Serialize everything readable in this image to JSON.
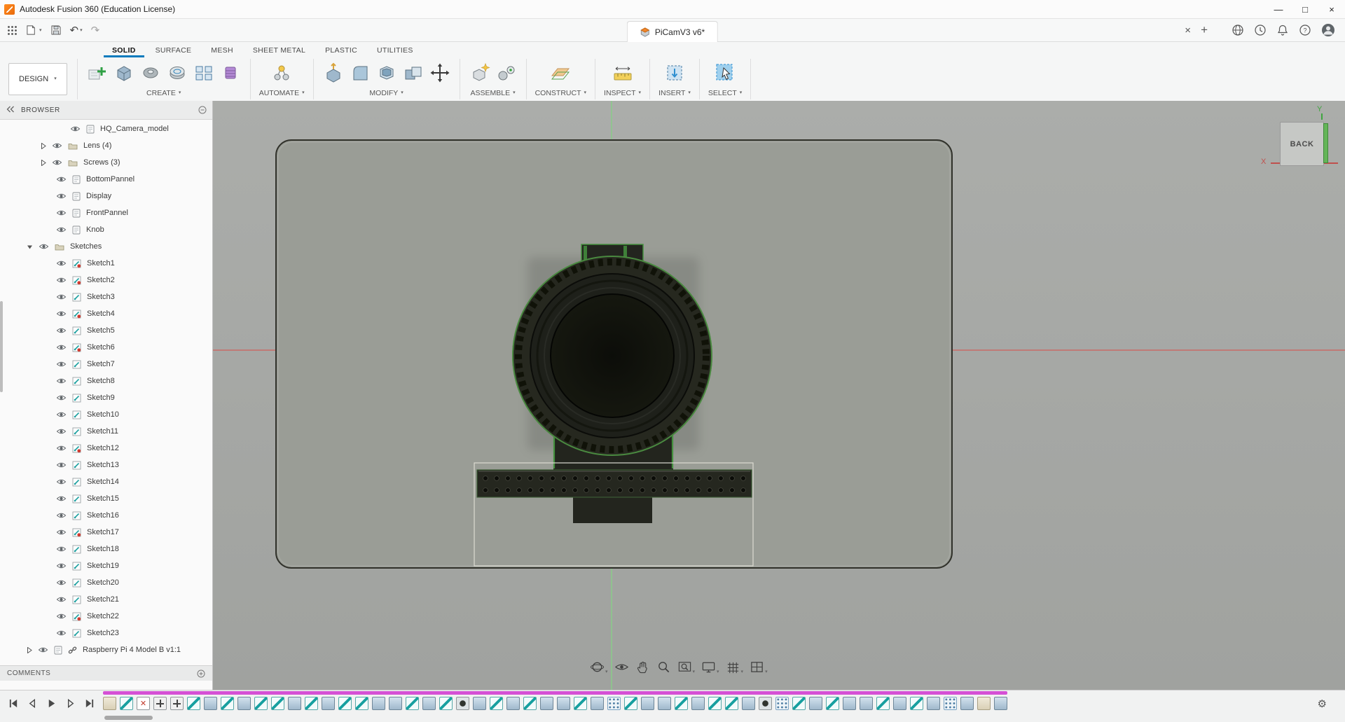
{
  "app": {
    "title": "Autodesk Fusion 360 (Education License)",
    "document_tab": "PiCamV3 v6*"
  },
  "window_controls": [
    "minimize",
    "maximize",
    "close"
  ],
  "quick_access": [
    "app-grid",
    "file-menu",
    "save",
    "undo",
    "redo"
  ],
  "tab_controls": [
    "close-document",
    "new-document"
  ],
  "account_area": [
    "extensions-web",
    "job-status-clock",
    "notifications-bell",
    "help",
    "profile-avatar"
  ],
  "ribbon": {
    "file_tabs": [
      "SOLID",
      "SURFACE",
      "MESH",
      "SHEET METAL",
      "PLASTIC",
      "UTILITIES"
    ],
    "active_tab": "SOLID",
    "design_dropdown": "DESIGN",
    "groups": [
      {
        "label": "CREATE",
        "icons": [
          "create-sketch",
          "box",
          "revolve",
          "sweep",
          "rectangular-pattern",
          "coil"
        ]
      },
      {
        "label": "AUTOMATE",
        "icons": [
          "automate"
        ]
      },
      {
        "label": "MODIFY",
        "icons": [
          "press-pull",
          "fillet",
          "shell",
          "combine",
          "move"
        ]
      },
      {
        "label": "ASSEMBLE",
        "icons": [
          "new-component",
          "joint"
        ]
      },
      {
        "label": "CONSTRUCT",
        "icons": [
          "construction-plane"
        ]
      },
      {
        "label": "INSPECT",
        "icons": [
          "measure"
        ]
      },
      {
        "label": "INSERT",
        "icons": [
          "insert-mesh"
        ]
      },
      {
        "label": "SELECT",
        "icons": [
          "select"
        ]
      }
    ]
  },
  "browser": {
    "header": "BROWSER",
    "items": [
      {
        "label": "HQ_Camera_model",
        "type": "component-root"
      },
      {
        "label": "Lens (4)",
        "type": "folder"
      },
      {
        "label": "Screws (3)",
        "type": "folder"
      },
      {
        "label": "BottomPannel",
        "type": "component"
      },
      {
        "label": "Display",
        "type": "component"
      },
      {
        "label": "FrontPannel",
        "type": "component"
      },
      {
        "label": "Knob",
        "type": "component"
      },
      {
        "label": "Sketches",
        "type": "folder-open"
      },
      {
        "label": "Sketch1",
        "type": "sketch",
        "locked": true
      },
      {
        "label": "Sketch2",
        "type": "sketch",
        "locked": true
      },
      {
        "label": "Sketch3",
        "type": "sketch"
      },
      {
        "label": "Sketch4",
        "type": "sketch",
        "locked": true
      },
      {
        "label": "Sketch5",
        "type": "sketch"
      },
      {
        "label": "Sketch6",
        "type": "sketch",
        "locked": true
      },
      {
        "label": "Sketch7",
        "type": "sketch"
      },
      {
        "label": "Sketch8",
        "type": "sketch"
      },
      {
        "label": "Sketch9",
        "type": "sketch"
      },
      {
        "label": "Sketch10",
        "type": "sketch"
      },
      {
        "label": "Sketch11",
        "type": "sketch"
      },
      {
        "label": "Sketch12",
        "type": "sketch",
        "locked": true
      },
      {
        "label": "Sketch13",
        "type": "sketch"
      },
      {
        "label": "Sketch14",
        "type": "sketch"
      },
      {
        "label": "Sketch15",
        "type": "sketch"
      },
      {
        "label": "Sketch16",
        "type": "sketch"
      },
      {
        "label": "Sketch17",
        "type": "sketch",
        "locked": true
      },
      {
        "label": "Sketch18",
        "type": "sketch"
      },
      {
        "label": "Sketch19",
        "type": "sketch"
      },
      {
        "label": "Sketch20",
        "type": "sketch"
      },
      {
        "label": "Sketch21",
        "type": "sketch"
      },
      {
        "label": "Sketch22",
        "type": "sketch",
        "locked": true
      },
      {
        "label": "Sketch23",
        "type": "sketch"
      },
      {
        "label": "Raspberry Pi 4 Model B v1:1",
        "type": "linked"
      }
    ]
  },
  "comments": {
    "label": "COMMENTS"
  },
  "viewcube": {
    "face_label": "BACK",
    "x_label": "X",
    "y_label": "Y"
  },
  "nav_bar": {
    "items": [
      "orbit",
      "look-at",
      "pan",
      "zoom",
      "fit",
      "display-settings",
      "grid-and-snaps",
      "viewports"
    ]
  },
  "playback": [
    "go-to-start",
    "step-back",
    "play",
    "step-forward",
    "go-to-end"
  ],
  "timeline": {
    "items": [
      "component",
      "sketch",
      "delete",
      "move",
      "move",
      "sketch",
      "extrude",
      "sketch",
      "extrude",
      "sketch",
      "sketch",
      "extrude",
      "sketch",
      "extrude",
      "sketch",
      "sketch",
      "extrude",
      "extrude",
      "sketch",
      "extrude",
      "sketch",
      "hole",
      "extrude",
      "sketch",
      "extrude",
      "sketch",
      "extrude",
      "extrude",
      "sketch",
      "extrude",
      "pattern",
      "sketch",
      "extrude",
      "extrude",
      "sketch",
      "extrude",
      "sketch",
      "sketch",
      "extrude",
      "hole",
      "pattern",
      "sketch",
      "extrude",
      "sketch",
      "extrude",
      "extrude",
      "sketch",
      "extrude",
      "sketch",
      "extrude",
      "pattern",
      "extrude",
      "component",
      "extrude"
    ]
  },
  "colors": {
    "accent": "#0a7bbd",
    "canvas_bg": "#a5a7a4",
    "model_body": "#9a9d96",
    "model_edge_green": "#44903e",
    "axis_x_red": "#c96a66",
    "axis_y_green": "#8bc98b",
    "timeline_group_band": "#d550d5"
  }
}
